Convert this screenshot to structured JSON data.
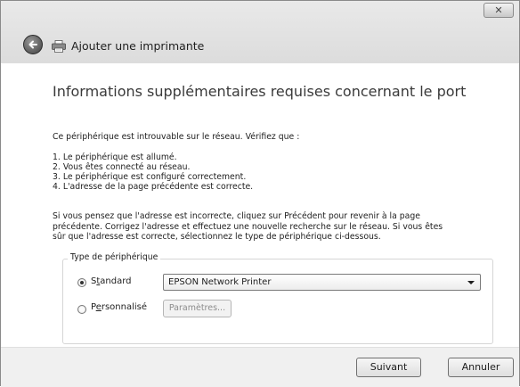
{
  "window": {
    "title": "Ajouter une imprimante",
    "close_glyph": "✕"
  },
  "content": {
    "heading": "Informations supplémentaires requises concernant le port",
    "intro": "Ce périphérique est introuvable sur le réseau. Vérifiez que :",
    "checklist": [
      "1.  Le périphérique est allumé.",
      "2.  Vous êtes connecté au réseau.",
      "3.  Le périphérique est configuré correctement.",
      "4.  L'adresse de la page précédente est correcte."
    ],
    "paragraph_lines": [
      "Si vous pensez que l'adresse est incorrecte, cliquez sur Précédent pour revenir à la page",
      "précédente. Corrigez l'adresse et effectuez une nouvelle recherche sur le réseau. Si vous êtes",
      "sûr que l'adresse est correcte, sélectionnez le type de périphérique ci-dessous."
    ]
  },
  "device_type": {
    "legend": "Type de périphérique",
    "standard_label_pre": "S",
    "standard_label_ul": "t",
    "standard_label_post": "andard",
    "custom_label_pre": "P",
    "custom_label_ul": "e",
    "custom_label_post": "rsonnalisé",
    "selected": "standard",
    "standard_value": "EPSON Network Printer",
    "params_label": "Paramètres..."
  },
  "footer": {
    "next_label": "Suivant",
    "cancel_label": "Annuler"
  },
  "icons": {
    "back": "back-arrow-icon",
    "printer": "printer-icon",
    "close": "close-icon",
    "dropdown": "chevron-down-icon"
  }
}
